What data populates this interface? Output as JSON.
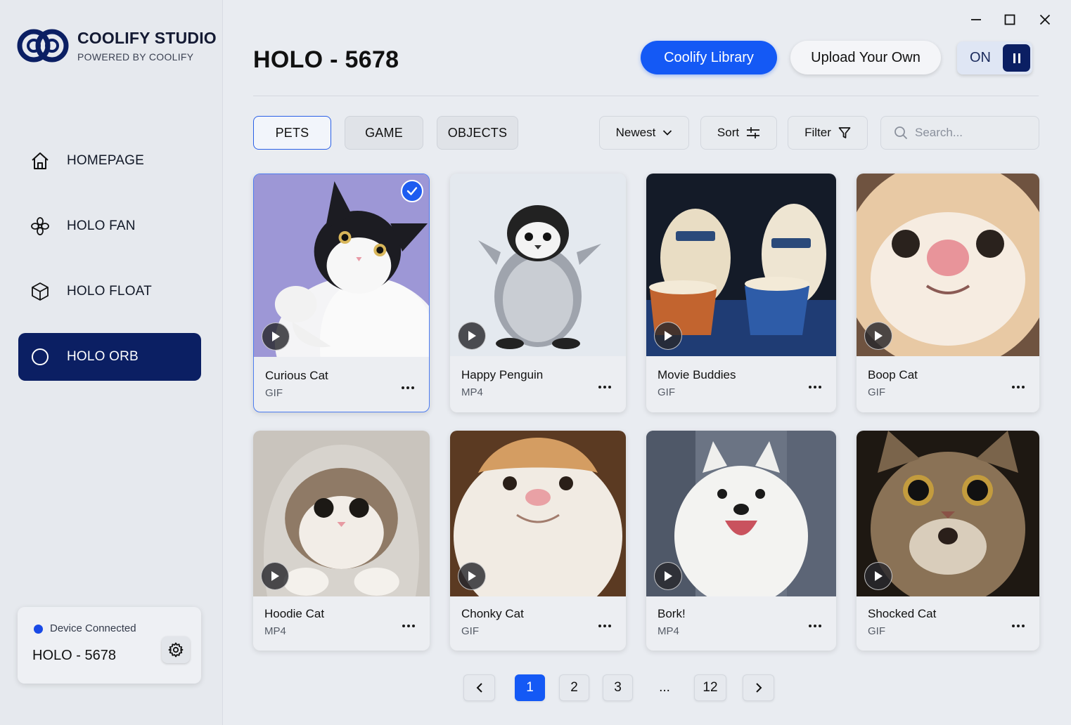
{
  "app": {
    "name": "COOLIFY STUDIO",
    "tagline": "POWERED BY COOLIFY"
  },
  "sidebar": {
    "items": [
      {
        "label": "HOMEPAGE",
        "icon": "home-icon",
        "active": false
      },
      {
        "label": "HOLO FAN",
        "icon": "fan-icon",
        "active": false
      },
      {
        "label": "HOLO FLOAT",
        "icon": "cube-icon",
        "active": false
      },
      {
        "label": "HOLO ORB",
        "icon": "orb-icon",
        "active": true
      }
    ],
    "device": {
      "status": "Device Connected",
      "name": "HOLO - 5678",
      "status_color": "#1849e6"
    }
  },
  "header": {
    "title": "HOLO - 5678",
    "library_label": "Coolify Library",
    "upload_label": "Upload Your Own",
    "toggle_label": "ON"
  },
  "filters": {
    "categories": [
      {
        "label": "PETS",
        "active": true
      },
      {
        "label": "GAME",
        "active": false
      },
      {
        "label": "OBJECTS",
        "active": false
      }
    ],
    "order": "Newest",
    "sort_label": "Sort",
    "filter_label": "Filter",
    "search_placeholder": "Search..."
  },
  "cards": [
    {
      "title": "Curious Cat",
      "type": "GIF",
      "selected": true
    },
    {
      "title": "Happy Penguin",
      "type": "MP4",
      "selected": false
    },
    {
      "title": "Movie Buddies",
      "type": "GIF",
      "selected": false
    },
    {
      "title": "Boop Cat",
      "type": "GIF",
      "selected": false
    },
    {
      "title": "Hoodie Cat",
      "type": "MP4",
      "selected": false
    },
    {
      "title": "Chonky Cat",
      "type": "GIF",
      "selected": false
    },
    {
      "title": "Bork!",
      "type": "MP4",
      "selected": false
    },
    {
      "title": "Shocked Cat",
      "type": "GIF",
      "selected": false
    }
  ],
  "pagination": {
    "pages": [
      "1",
      "2",
      "3",
      "12"
    ],
    "ellipsis": "...",
    "current": "1"
  },
  "colors": {
    "accent": "#1459f5",
    "nav_active": "#0b1f63"
  }
}
